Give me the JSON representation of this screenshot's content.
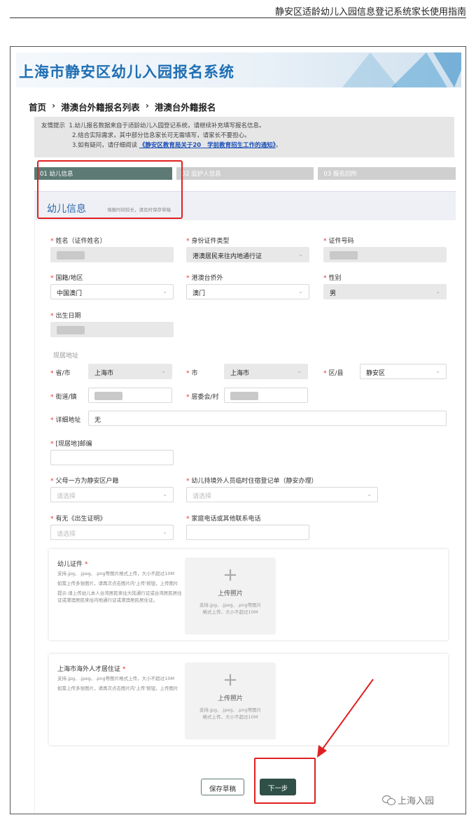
{
  "doc_header": "静安区适龄幼儿入园信息登记系统家长使用指南",
  "banner_title": "上海市静安区幼儿入园报名系统",
  "breadcrumb": [
    "首页",
    "港澳台外籍报名列表",
    "港澳台外籍报名"
  ],
  "breadcrumb_sep": "›",
  "tips": {
    "prefix": "友情提示",
    "line1": "1.幼儿报名数据来自于适龄幼儿入园登记系统，请继续补充填写报名信息。",
    "line2": "2.结合实际需求，其中部分信息家长可无需填写，请家长不要担心。",
    "line3_pre": "3.如有疑问，请仔细阅读",
    "line3_link": "《静安区教育局关于20",
    "line3_link2": "学前教育招生工作的通知》",
    "line3_post": "。"
  },
  "steps": [
    "01 幼儿信息",
    "02 监护人信息",
    "03 报名回所"
  ],
  "section": {
    "title": "幼儿信息",
    "note": "填报时间较长，请及时保存草稿"
  },
  "fields": {
    "name_label": "姓名（证件姓名）",
    "idtype_label": "身份证件类型",
    "idtype_value": "港澳居民来往内地通行证",
    "idno_label": "证件号码",
    "nationality_label": "国籍/地区",
    "nationality_value": "中国澳门",
    "overseas_label": "港澳台侨外",
    "overseas_value": "澳门",
    "gender_label": "性别",
    "gender_value": "男",
    "birth_label": "出生日期",
    "address_section": "现居地址",
    "province_label": "省/市",
    "province_value": "上海市",
    "city_label": "市",
    "city_value": "上海市",
    "district_label": "区/县",
    "district_value": "静安区",
    "street_label": "街道/镇",
    "committee_label": "居委会/村",
    "detail_label": "详细地址",
    "detail_value": "无",
    "postcode_label": "[现居地]邮编",
    "hukou_label": "父母一方为静安区户籍",
    "hukou_placeholder": "请选择",
    "residence_label": "幼儿持境外人员临时住宿登记单（静安办理）",
    "residence_placeholder": "请选择",
    "birthcert_label": "有无《出生证明》",
    "birthcert_placeholder": "请选择",
    "phone_label": "家庭电话或其他联系电话"
  },
  "uploads": [
    {
      "title": "幼儿证件",
      "desc1": "支持.jpg、.jpeg、.png等图片格式上传，大小不超过10M",
      "desc2": "如需上传多张图片，请再次点击图片内'上传'按钮，上传图片",
      "desc3": "提示:请上传幼儿本人台湾居民来往大陆通行证或台湾居民居住证或港澳居民来往内地通行证或港澳居民居住证。",
      "box_label": "上传照片",
      "box_hint": "支持.jpg、.jpeg、.png等图片格式上传，大小不超过10M"
    },
    {
      "title": "上海市海外人才居住证",
      "desc1": "支持.jpg、.jpeg、.png等图片格式上传，大小不超过10M",
      "desc2": "如需上传多张图片，请再次点击图片内'上传'按钮，上传图片",
      "desc3": "",
      "box_label": "上传照片",
      "box_hint": "支持.jpg、.jpeg、.png等图片格式上传，大小不超过10M"
    }
  ],
  "buttons": {
    "save_draft": "保存草稿",
    "next": "下一步"
  },
  "watermark": "上海入园",
  "colors": {
    "brand_blue": "#1f6fb4",
    "step_active": "#5d7a74",
    "primary_button": "#2f4f47",
    "highlight_red": "#e02020",
    "required": "#e0312e"
  }
}
